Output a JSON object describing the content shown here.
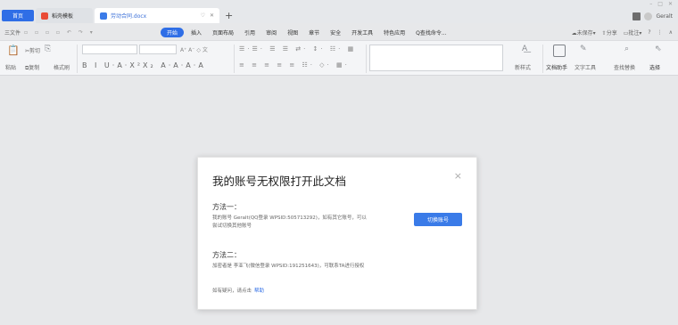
{
  "tabs": {
    "home": "首页",
    "template": "稻壳模板",
    "document": "劳动合同.docx"
  },
  "window": {
    "user_name": "Geralt"
  },
  "menu": {
    "file": "三文件",
    "items": [
      "开始",
      "插入",
      "页面布局",
      "引用",
      "审阅",
      "视图",
      "章节",
      "安全",
      "开发工具",
      "特色应用"
    ],
    "search": "Q查找命令...",
    "unsaved": "未保存",
    "share": "分享",
    "comment": "批注",
    "help": "?"
  },
  "ribbon": {
    "cut": "剪切",
    "paste": "粘贴",
    "copy": "复制",
    "format_painter": "格式刷",
    "new_style": "新样式",
    "doc_assistant": "文档助手",
    "text_tools": "文字工具",
    "find_replace": "查找替换",
    "select": "选择"
  },
  "dialog": {
    "title": "我的账号无权限打开此文档",
    "method1_heading": "方法一：",
    "method1_line1": "我的账号 Geralt(QQ登录 WPSID:505713292)，如有其它账号，可以",
    "method1_line2": "尝试切换其他账号",
    "switch_button": "切换账号",
    "method2_heading": "方法二：",
    "method2_line1": "加密者是 李亚飞(微信登录 WPSID:191251643)，可联系TA进行授权",
    "help_prefix": "如有疑问，请点击",
    "help_link": "帮助",
    "close": "×"
  },
  "colors": {
    "accent": "#2f6ee6",
    "button": "#3a7be8",
    "background": "#e7e8ea"
  }
}
